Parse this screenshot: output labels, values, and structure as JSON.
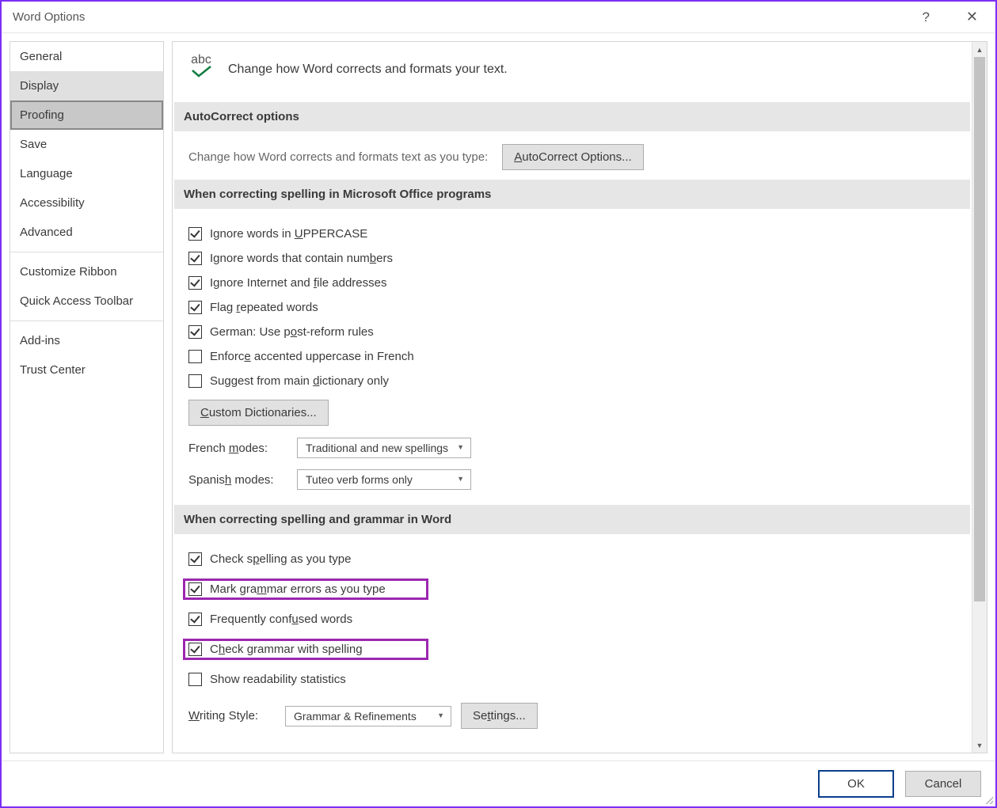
{
  "titlebar": {
    "title": "Word Options"
  },
  "sidebar": [
    {
      "id": "general",
      "label": "General"
    },
    {
      "id": "display",
      "label": "Display"
    },
    {
      "id": "proofing",
      "label": "Proofing"
    },
    {
      "id": "save",
      "label": "Save"
    },
    {
      "id": "language",
      "label": "Language"
    },
    {
      "id": "accessibility",
      "label": "Accessibility"
    },
    {
      "id": "advanced",
      "label": "Advanced"
    },
    {
      "id": "customize-ribbon",
      "label": "Customize Ribbon"
    },
    {
      "id": "quick-access-toolbar",
      "label": "Quick Access Toolbar"
    },
    {
      "id": "add-ins",
      "label": "Add-ins"
    },
    {
      "id": "trust-center",
      "label": "Trust Center"
    }
  ],
  "header": {
    "abc": "abc",
    "text": "Change how Word corrects and formats your text."
  },
  "sections": {
    "autocorrect": {
      "title": "AutoCorrect options",
      "desc": "Change how Word corrects and formats text as you type:",
      "button": "AutoCorrect Options..."
    },
    "spelling_office": {
      "title": "When correcting spelling in Microsoft Office programs",
      "checks": [
        {
          "id": "ignore-uppercase",
          "checked": true,
          "pre": "Ignore words in ",
          "u": "U",
          "post": "PPERCASE"
        },
        {
          "id": "ignore-numbers",
          "checked": true,
          "pre": "Ignore words that contain num",
          "u": "b",
          "post": "ers"
        },
        {
          "id": "ignore-internet",
          "checked": true,
          "pre": "Ignore Internet and ",
          "u": "f",
          "post": "ile addresses"
        },
        {
          "id": "flag-repeated",
          "checked": true,
          "pre": "Flag ",
          "u": "r",
          "post": "epeated words"
        },
        {
          "id": "german-post",
          "checked": true,
          "pre": "German: Use p",
          "u": "o",
          "post": "st-reform rules"
        },
        {
          "id": "enforce-accented",
          "checked": false,
          "pre": "Enforc",
          "u": "e",
          "post": " accented uppercase in French"
        },
        {
          "id": "suggest-main",
          "checked": false,
          "pre": "Suggest from main ",
          "u": "d",
          "post": "ictionary only"
        }
      ],
      "custom_dict_btn": "Custom Dictionaries...",
      "french_label": "French modes:",
      "french_value": "Traditional and new spellings",
      "spanish_label": "Spanish modes:",
      "spanish_value": "Tuteo verb forms only"
    },
    "spelling_word": {
      "title": "When correcting spelling and grammar in Word",
      "checks": [
        {
          "id": "check-spelling-type",
          "checked": true,
          "pre": "Check s",
          "u": "p",
          "post": "elling as you type",
          "highlight": false
        },
        {
          "id": "mark-grammar",
          "checked": true,
          "pre": "Mark gra",
          "u": "m",
          "post": "mar errors as you type",
          "highlight": true
        },
        {
          "id": "frequently-confused",
          "checked": true,
          "pre": "Frequently conf",
          "u": "u",
          "post": "sed words",
          "highlight": false
        },
        {
          "id": "check-grammar-spelling",
          "checked": true,
          "pre": "C",
          "u": "h",
          "post": "eck grammar with spelling",
          "highlight": true
        },
        {
          "id": "show-readability",
          "checked": false,
          "pre": "Show readability statistics",
          "u": "",
          "post": "",
          "highlight": false
        }
      ],
      "writing_style_label": "Writing Style:",
      "writing_style_value": "Grammar & Refinements",
      "settings_btn": "Settings..."
    }
  },
  "footer": {
    "ok": "OK",
    "cancel": "Cancel"
  }
}
